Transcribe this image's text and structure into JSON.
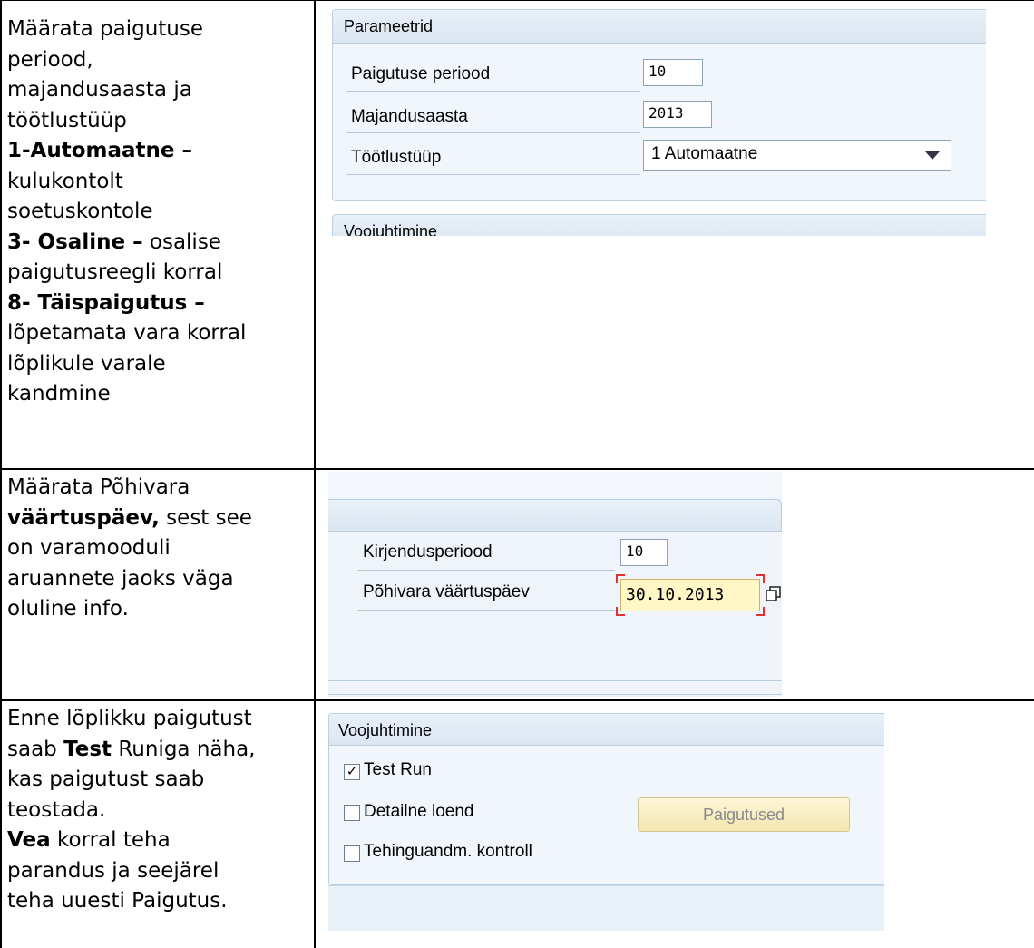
{
  "rows": [
    {
      "lines": [
        [
          {
            "t": "Määrata paigutuse",
            "b": false
          }
        ],
        [
          {
            "t": "periood,",
            "b": false
          }
        ],
        [
          {
            "t": "majandusaasta ja",
            "b": false
          }
        ],
        [
          {
            "t": "töötlustüüp",
            "b": false
          }
        ],
        [
          {
            "t": " 1-Automaatne –",
            "b": true
          }
        ],
        [
          {
            "t": "kulukontolt",
            "b": false
          }
        ],
        [
          {
            "t": "soetuskontole",
            "b": false
          }
        ],
        [
          {
            "t": "3- Osaline –",
            "b": true
          },
          {
            "t": " osalise",
            "b": false
          }
        ],
        [
          {
            "t": "paigutusreegli korral",
            "b": false
          }
        ],
        [
          {
            "t": "8- Täispaigutus –",
            "b": true
          }
        ],
        [
          {
            "t": "lõpetamata vara korral",
            "b": false
          }
        ],
        [
          {
            "t": "lõplikule varale",
            "b": false
          }
        ],
        [
          {
            "t": "kandmine",
            "b": false
          }
        ]
      ]
    },
    {
      "lines": [
        [
          {
            "t": "Määrata Põhivara",
            "b": false
          }
        ],
        [
          {
            "t": "väärtuspäev,",
            "b": true
          },
          {
            "t": " sest see",
            "b": false
          }
        ],
        [
          {
            "t": "on varamooduli",
            "b": false
          }
        ],
        [
          {
            "t": "aruannete jaoks väga",
            "b": false
          }
        ],
        [
          {
            "t": "oluline info.",
            "b": false
          }
        ]
      ]
    },
    {
      "lines": [
        [
          {
            "t": "Enne lõplikku paigutust",
            "b": false
          }
        ],
        [
          {
            "t": "saab ",
            "b": false
          },
          {
            "t": "Test",
            "b": true
          },
          {
            "t": " Runiga näha,",
            "b": false
          }
        ],
        [
          {
            "t": "kas paigutust saab",
            "b": false
          }
        ],
        [
          {
            "t": "teostada.",
            "b": false
          }
        ],
        [
          {
            "t": "Vea",
            "b": true
          },
          {
            "t": " korral teha",
            "b": false
          }
        ],
        [
          {
            "t": "parandus ja seejärel",
            "b": false
          }
        ],
        [
          {
            "t": "teha uuesti Paigutus.",
            "b": false
          }
        ]
      ]
    }
  ],
  "params_panel": {
    "title": "Parameetrid",
    "fields": [
      {
        "label": "Paigutuse periood",
        "value": "10"
      },
      {
        "label": "Majandusaasta",
        "value": "2013"
      },
      {
        "label": "Töötlustüüp",
        "value": "1 Automaatne"
      }
    ],
    "next_title": "Voojuhtimine"
  },
  "posting_panel": {
    "fields": [
      {
        "label": "Kirjendusperiood",
        "value": "10"
      },
      {
        "label": "Põhivara väärtuspäev",
        "value": "30.10.2013"
      }
    ]
  },
  "flow_panel": {
    "title": "Voojuhtimine",
    "checkboxes": [
      {
        "label": "Test Run",
        "checked": true
      },
      {
        "label": "Detailne loend",
        "checked": false
      },
      {
        "label": "Tehinguandm. kontroll",
        "checked": false
      }
    ],
    "button_label": "Paigutused"
  },
  "icons": {
    "dropdown": "chevron-down-icon",
    "value_help": "copy-icon",
    "check": "checkmark-icon"
  }
}
